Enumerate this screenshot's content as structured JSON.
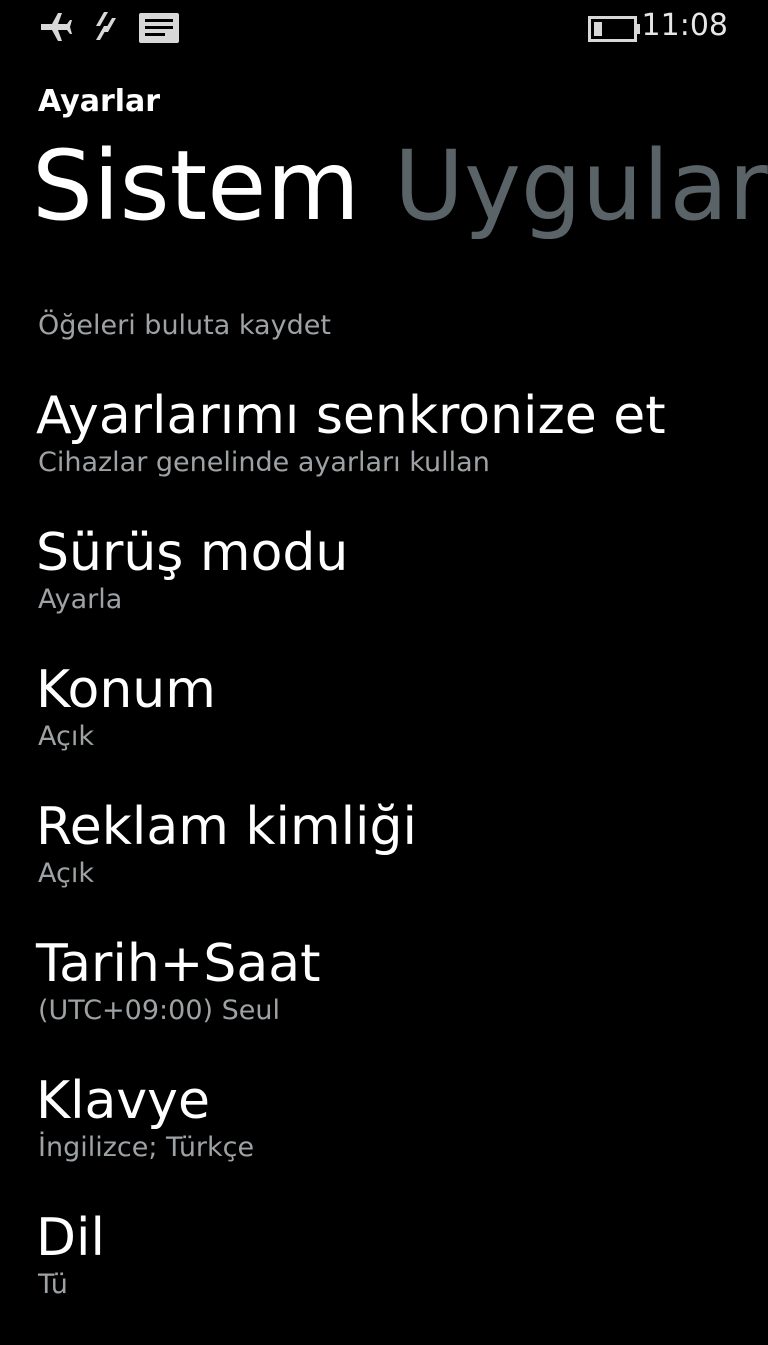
{
  "status_bar": {
    "icons": [
      "airplane-icon",
      "data-connection-icon",
      "message-notification-icon",
      "battery-icon"
    ],
    "time": "11:08"
  },
  "app_title": "Ayarlar",
  "pivot": {
    "tabs": [
      {
        "label": "Sistem",
        "active": true
      },
      {
        "label": "Uygular",
        "active": false
      }
    ]
  },
  "section": {
    "label": "Öğeleri buluta kaydet"
  },
  "settings": [
    {
      "title": "Ayarlarımı senkronize et",
      "subtitle": "Cihazlar genelinde ayarları kullan"
    },
    {
      "title": "Sürüş modu",
      "subtitle": "Ayarla"
    },
    {
      "title": "Konum",
      "subtitle": "Açık"
    },
    {
      "title": "Reklam kimliği",
      "subtitle": "Açık"
    },
    {
      "title": "Tarih+Saat",
      "subtitle": "(UTC+09:00) Seul"
    },
    {
      "title": "Klavye",
      "subtitle": "İngilizce; Türkçe"
    },
    {
      "title": "Dil",
      "subtitle": "Tü"
    }
  ],
  "colors": {
    "background": "#000000",
    "primary_text": "#ffffff",
    "secondary_text": "#9ea2a4",
    "inactive_tab": "#5a6367"
  }
}
